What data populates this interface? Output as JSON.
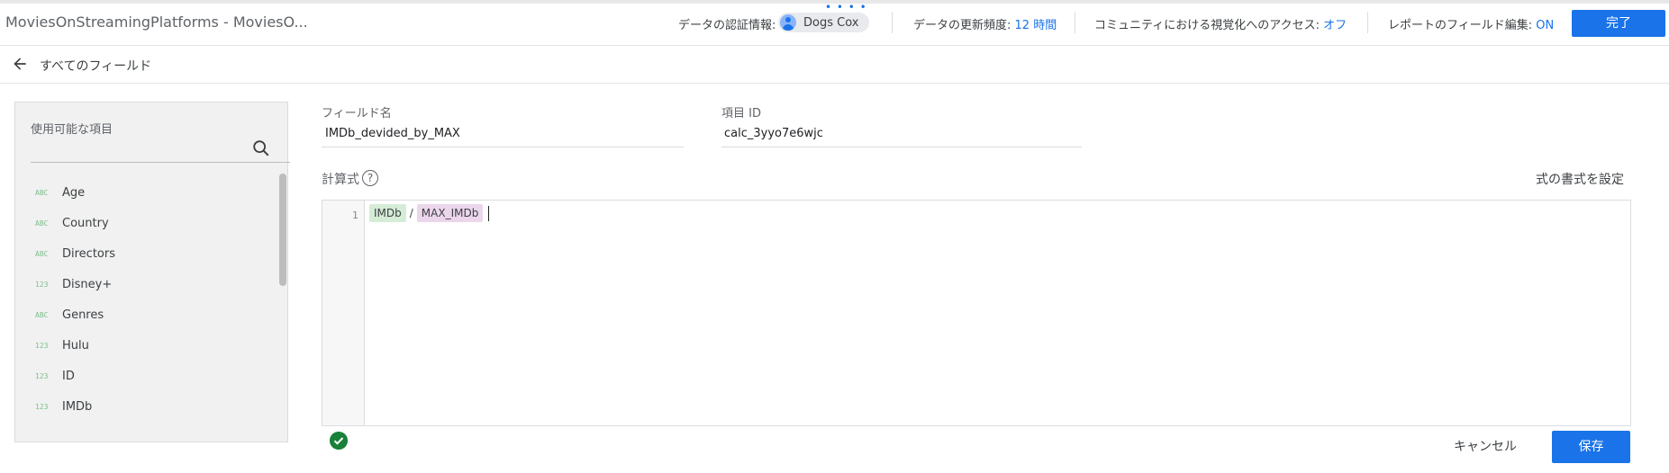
{
  "header": {
    "app_title": "MoviesOnStreamingPlatforms - MoviesO...",
    "credentials_label": "データの認証情報:",
    "credentials_user": "Dogs Cox",
    "freshness_label": "データの更新頻度:",
    "freshness_value": "12 時間",
    "community_label": "コミュニティにおける視覚化へのアクセス:",
    "community_value": "オフ",
    "report_edit_label": "レポートのフィールド編集:",
    "report_edit_value": "ON",
    "done_button": "完了"
  },
  "nav": {
    "back_label": "すべてのフィールド"
  },
  "sidebar": {
    "title": "使用可能な項目",
    "items": [
      {
        "type": "ABC",
        "name": "Age"
      },
      {
        "type": "ABC",
        "name": "Country"
      },
      {
        "type": "ABC",
        "name": "Directors"
      },
      {
        "type": "123",
        "name": "Disney+"
      },
      {
        "type": "ABC",
        "name": "Genres"
      },
      {
        "type": "123",
        "name": "Hulu"
      },
      {
        "type": "123",
        "name": "ID"
      },
      {
        "type": "123",
        "name": "IMDb"
      }
    ]
  },
  "form": {
    "field_name_label": "フィールド名",
    "field_name_value": "IMDb_devided_by_MAX",
    "field_id_label": "項目 ID",
    "field_id_value": "calc_3yyo7e6wjc",
    "formula_label": "計算式",
    "help_glyph": "?",
    "format_link": "式の書式を設定"
  },
  "editor": {
    "line_number": "1",
    "token_dimension": "IMDb",
    "operator": "/",
    "token_metric": "MAX_IMDb"
  },
  "footer": {
    "cancel_button": "キャンセル",
    "save_button": "保存"
  },
  "colors": {
    "accent": "#1a73e8",
    "valid": "#188038",
    "dimension_token": "#d5ecd7",
    "metric_token": "#ecd6ec"
  }
}
